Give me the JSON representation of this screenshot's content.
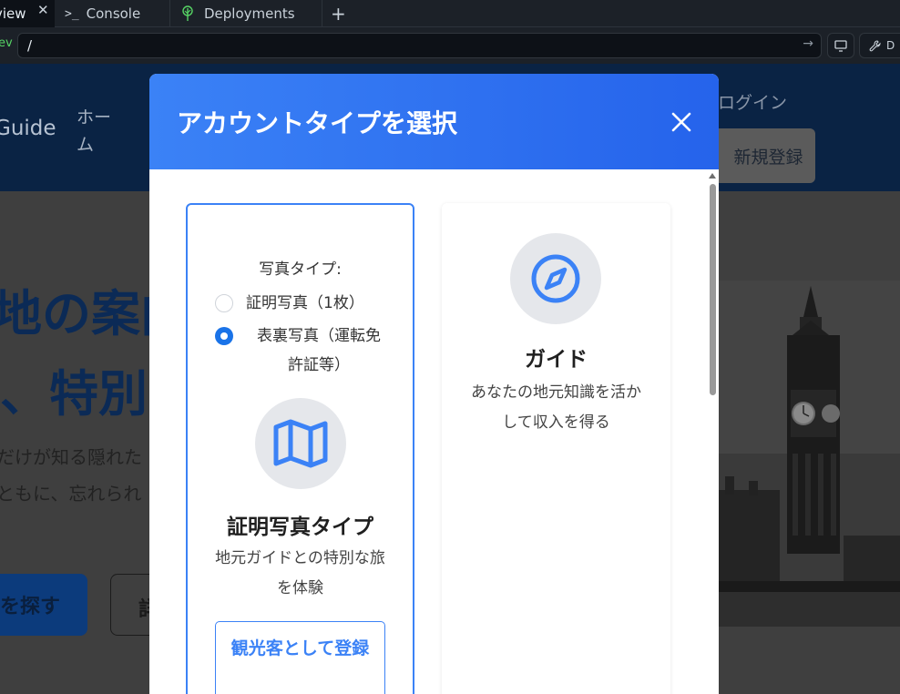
{
  "ide": {
    "tabs": [
      {
        "label": "view",
        "close": "✕"
      },
      {
        "label": "Console",
        "icon": "terminal-prompt-icon"
      },
      {
        "label": "Deployments",
        "icon": "deploy-tree-icon"
      }
    ],
    "add_tab": "+",
    "url": {
      "env_prefix": "ev",
      "path": "/",
      "go_icon": "→"
    },
    "tools_label": "D"
  },
  "site": {
    "brand": "Guide",
    "nav_home": "ホーム",
    "login": "ログイン",
    "signup": "新規登録",
    "hero_line1": "地の案内",
    "hero_line2": "、特別な",
    "hero_sub1": "だけが知る隠れた",
    "hero_sub2": "ともに、忘れられ",
    "hero_btn_primary": "を探す",
    "hero_btn_secondary": "詳"
  },
  "modal": {
    "title": "アカウントタイプを選択",
    "header_gradient": [
      "#3b82f6",
      "#2563eb"
    ],
    "accent": "#3b82f6",
    "cards": [
      {
        "photo_type_label": "写真タイプ:",
        "options": [
          {
            "label": "証明写真（1枚）",
            "selected": false
          },
          {
            "label": "表裏写真（運転免許証等）",
            "selected": true
          }
        ],
        "icon": "map-icon",
        "title": "証明写真タイプ",
        "description": "地元ガイドとの特別な旅を体験",
        "button": "観光客として登録",
        "selected": true
      },
      {
        "icon": "compass-icon",
        "title": "ガイド",
        "description": "あなたの地元知識を活かして収入を得る",
        "selected": false
      }
    ]
  }
}
